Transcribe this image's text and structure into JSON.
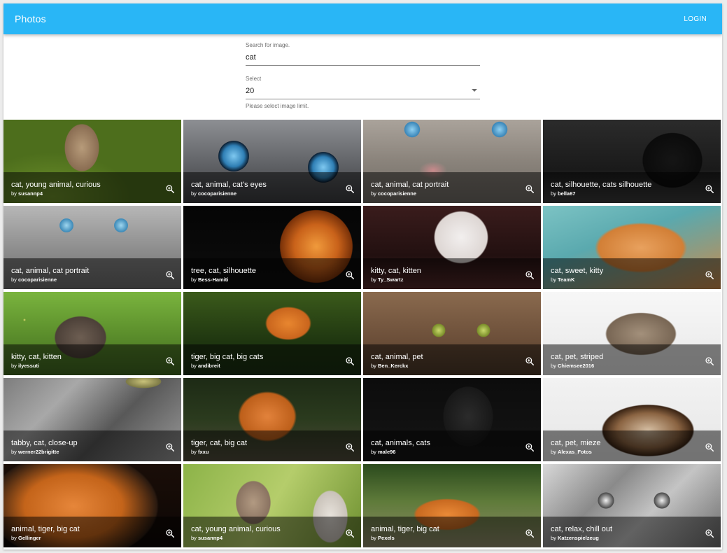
{
  "app": {
    "title": "Photos",
    "login_label": "LOGIN"
  },
  "search": {
    "label": "Search for image.",
    "value": "cat"
  },
  "limit": {
    "label": "Select",
    "value": "20",
    "helper": "Please select image limit."
  },
  "tiles": [
    {
      "title": "cat, young animal, curious",
      "by": "by",
      "author": "susannp4",
      "image": "img-kitten-grass"
    },
    {
      "title": "cat, animal, cat's eyes",
      "by": "by",
      "author": "cocoparisienne",
      "image": "img-blue-eyes"
    },
    {
      "title": "cat, animal, cat portrait",
      "by": "by",
      "author": "cocoparisienne",
      "image": "img-grey-portrait"
    },
    {
      "title": "cat, silhouette, cats silhouette",
      "by": "by",
      "author": "bella67",
      "image": "img-black-cat"
    },
    {
      "title": "cat, animal, cat portrait",
      "by": "by",
      "author": "cocoparisienne",
      "image": "img-grey-portrait2"
    },
    {
      "title": "tree, cat, silhouette",
      "by": "by",
      "author": "Bess-Hamiti",
      "image": "img-moon"
    },
    {
      "title": "kitty, cat, kitten",
      "by": "by",
      "author": "Ty_Swartz",
      "image": "img-white-kitten"
    },
    {
      "title": "cat, sweet, kitty",
      "by": "by",
      "author": "TeamK",
      "image": "img-orange-cat"
    },
    {
      "title": "kitty, cat, kitten",
      "by": "by",
      "author": "ilyessuti",
      "image": "img-tabby-grass"
    },
    {
      "title": "tiger, big cat, big cats",
      "by": "by",
      "author": "andibreit",
      "image": "img-tiger-water"
    },
    {
      "title": "cat, animal, pet",
      "by": "by",
      "author": "Ben_Kerckx",
      "image": "img-green-eyes"
    },
    {
      "title": "cat, pet, striped",
      "by": "by",
      "author": "Chiemsee2016",
      "image": "img-striped-cat"
    },
    {
      "title": "tabby, cat, close-up",
      "by": "by",
      "author": "werner22brigitte",
      "image": "img-tabby-close"
    },
    {
      "title": "tiger, cat, big cat",
      "by": "by",
      "author": "fxxu",
      "image": "img-tiger-roar"
    },
    {
      "title": "cat, animals, cats",
      "by": "by",
      "author": "male96",
      "image": "img-dark-cat"
    },
    {
      "title": "cat, pet, mieze",
      "by": "by",
      "author": "Alexas_Fotos",
      "image": "img-himalayan"
    },
    {
      "title": "animal, tiger, big cat",
      "by": "by",
      "author": "Gellinger",
      "image": "img-tiger-face"
    },
    {
      "title": "cat, young animal, curious",
      "by": "by",
      "author": "susannp4",
      "image": "img-kittens-green"
    },
    {
      "title": "animal, tiger, big cat",
      "by": "by",
      "author": "Pexels",
      "image": "img-tiger-lying"
    },
    {
      "title": "cat, relax, chill out",
      "by": "by",
      "author": "Katzenspielzeug",
      "image": "img-bw-cat"
    }
  ],
  "icons": {
    "zoom": "zoom-in-icon",
    "dropdown": "chevron-down-icon"
  },
  "colors": {
    "appbar": "#29b6f6",
    "tile_overlay": "rgba(0,0,0,0.5)"
  }
}
